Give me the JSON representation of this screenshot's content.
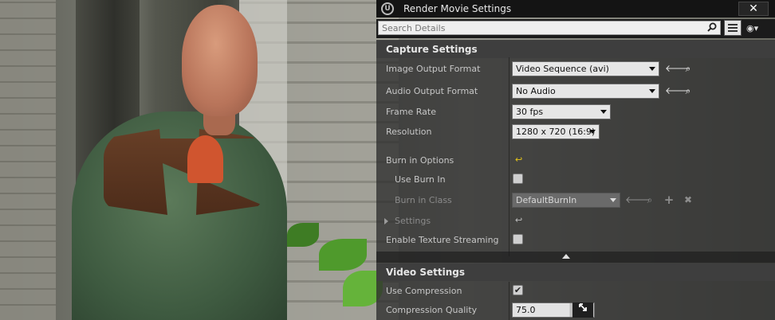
{
  "window": {
    "title": "Render Movie Settings",
    "close_glyph": "✕",
    "logo_glyph": "U"
  },
  "search": {
    "placeholder": "Search Details",
    "value": ""
  },
  "toolbar": {
    "view_icon": "view-options-icon",
    "list_icon": "property-matrix-icon",
    "eye_glyph": "◉▾"
  },
  "capture_settings": {
    "header": "Capture Settings",
    "image_output_format": {
      "label": "Image Output Format",
      "value": "Video Sequence (avi)"
    },
    "audio_output_format": {
      "label": "Audio Output Format",
      "value": "No Audio"
    },
    "frame_rate": {
      "label": "Frame Rate",
      "value": "30 fps"
    },
    "resolution": {
      "label": "Resolution",
      "value": "1280 x 720 (16:9)"
    },
    "burn_in_options": {
      "label": "Burn in Options"
    },
    "use_burn_in": {
      "label": "Use Burn In",
      "checked": false
    },
    "burn_in_class": {
      "label": "Burn in Class",
      "value": "DefaultBurnIn"
    },
    "settings": {
      "label": "Settings"
    },
    "enable_texture_streaming": {
      "label": "Enable Texture Streaming",
      "checked": false
    }
  },
  "video_settings": {
    "header": "Video Settings",
    "use_compression": {
      "label": "Use Compression",
      "checked": true,
      "check_glyph": "✔"
    },
    "compression_quality": {
      "label": "Compression Quality",
      "value": "75.0"
    }
  },
  "glyphs": {
    "back_arrow": "🡐",
    "browse": "⌕",
    "add": "+",
    "clear": "✖",
    "reset": "↩"
  },
  "colors": {
    "reset_highlight": "#e6c619",
    "panel_bg": "#2d2d2d",
    "title_bg": "#141414"
  }
}
